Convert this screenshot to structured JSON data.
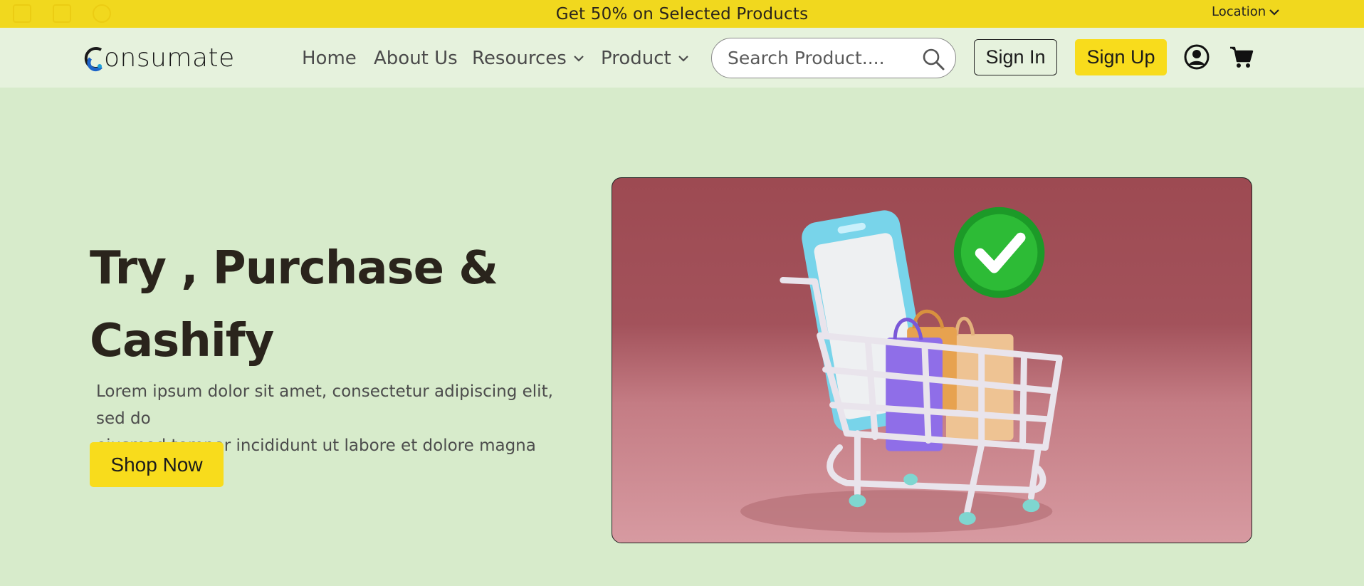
{
  "promo": {
    "text": "Get 50% on Selected Products",
    "background": "#f1d81e"
  },
  "location": {
    "label": "Location"
  },
  "logo": {
    "text": "onsumate"
  },
  "nav": {
    "home": "Home",
    "about": "About Us",
    "resources": "Resources",
    "product": "Product"
  },
  "search": {
    "placeholder": "Search Product...."
  },
  "auth": {
    "sign_in": "Sign In",
    "sign_up": "Sign Up"
  },
  "icons": [
    "search-icon",
    "user-icon",
    "cart-icon",
    "chevron-down-icon",
    "checkmark-icon"
  ],
  "hero": {
    "title_line1": "Try , Purchase &",
    "title_line2": "Cashify",
    "description_line1": "Lorem ipsum dolor sit amet, consectetur adipiscing elit, sed do",
    "description_line2": "eiusmod tempor incididunt ut labore et dolore magna aliqua.",
    "cta": "Shop Now"
  },
  "colors": {
    "page_background": "#d7ebcb",
    "accent_yellow": "#f8dc1c",
    "text_dark": "#2a241c"
  }
}
